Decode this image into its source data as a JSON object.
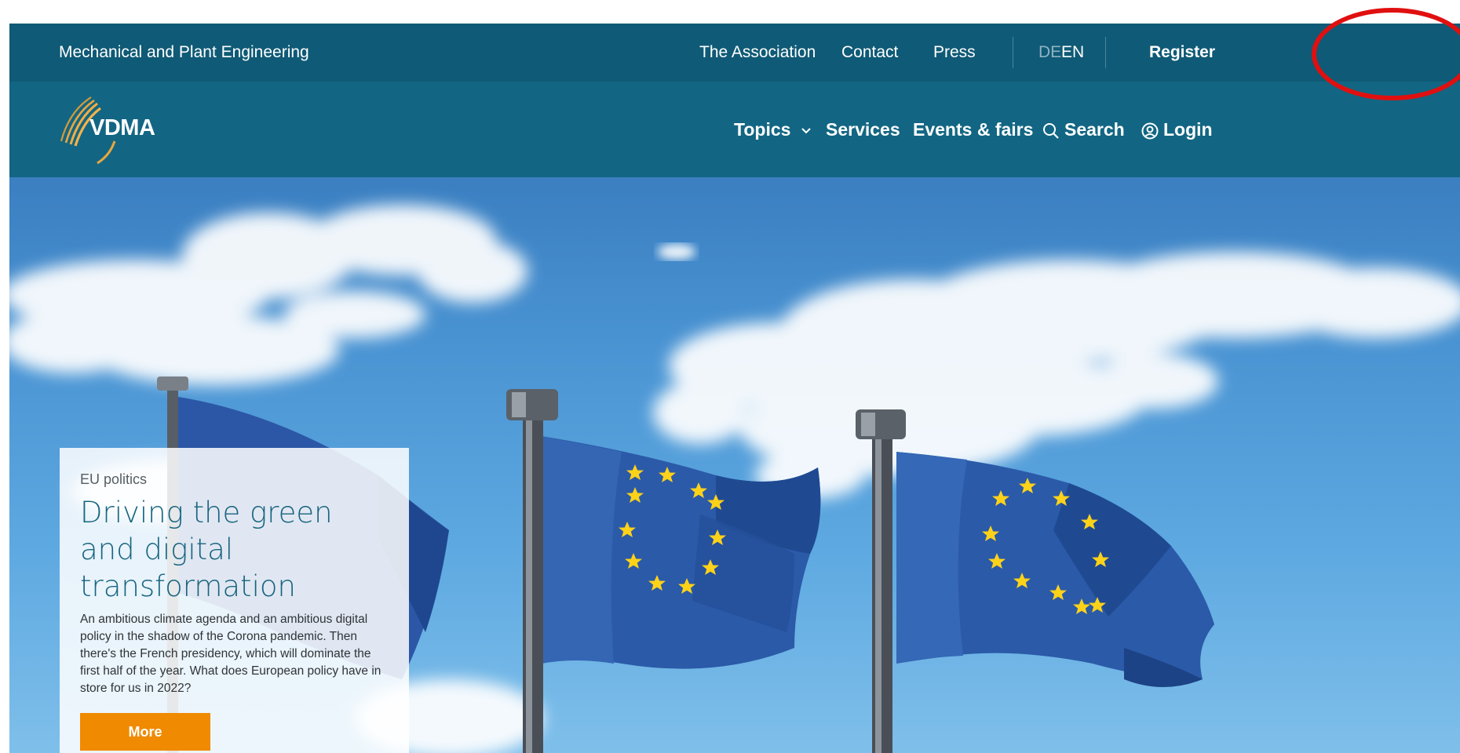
{
  "utility_bar": {
    "tagline": "Mechanical and Plant Engineering",
    "links": {
      "association": "The Association",
      "contact": "Contact",
      "press": "Press"
    },
    "lang_de": "DE",
    "lang_en": "EN",
    "register": "Register"
  },
  "main_nav": {
    "logo_text": "VDMA",
    "topics": "Topics",
    "services": "Services",
    "events": "Events & fairs",
    "search": "Search",
    "login": "Login"
  },
  "hero": {
    "kicker": "EU politics",
    "title": "Driving the green and digital transformation",
    "text": "An ambitious climate agenda and an ambitious digital policy in the shadow of the Corona pandemic. Then there's the French presidency, which will dominate the first half of the year. What does European policy have in store for us in 2022?",
    "button": "More"
  },
  "colors": {
    "utility_bar": "#0f5a76",
    "main_nav": "#126683",
    "accent": "#f08a00",
    "title": "#17657f",
    "annotation": "#e01010"
  },
  "icons": [
    "vdma-logo-icon",
    "chevron-down-icon",
    "search-icon",
    "user-circle-icon",
    "eu-flag-icon"
  ]
}
